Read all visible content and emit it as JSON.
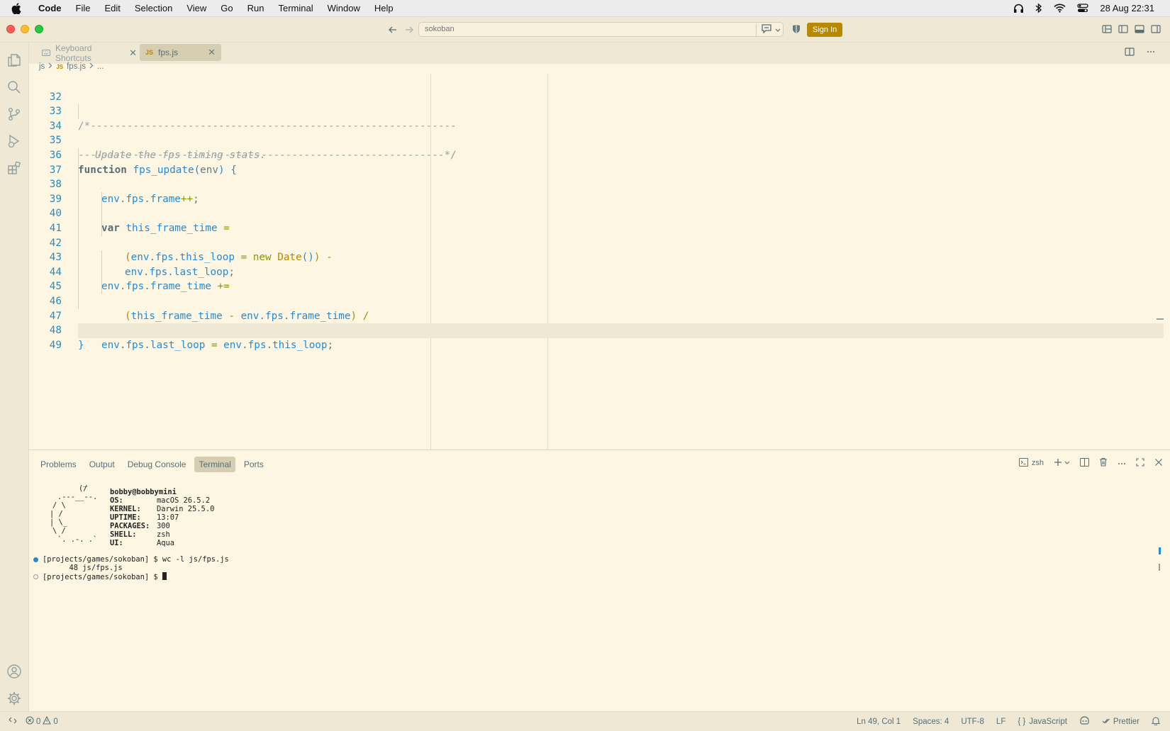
{
  "menubar": {
    "app": "Code",
    "items": [
      "File",
      "Edit",
      "Selection",
      "View",
      "Go",
      "Run",
      "Terminal",
      "Window",
      "Help"
    ],
    "clock": "28 Aug  22:31"
  },
  "titlebar": {
    "search": "sokoban",
    "signin": "Sign In"
  },
  "tabs": [
    {
      "label": "Keyboard Shortcuts",
      "active": false
    },
    {
      "label": "fps.js",
      "active": true,
      "icon": "JS"
    }
  ],
  "breadcrumb": {
    "folder": "js",
    "file_icon": "JS",
    "file": "fps.js",
    "more": "..."
  },
  "editor": {
    "line_numbers": [
      "32",
      "33",
      "34",
      "35",
      "36",
      "37",
      "38",
      "39",
      "40",
      "41",
      "42",
      "43",
      "44",
      "45",
      "46",
      "47",
      "48",
      "49"
    ],
    "comment_top": "/*------------------------------------------------------------",
    "comment_body": "Update the fps timing stats.",
    "comment_bottom": "------------------------------------------------------------*/"
  },
  "panel": {
    "tabs": [
      "Problems",
      "Output",
      "Debug Console",
      "Terminal",
      "Ports"
    ],
    "active_tab": "Terminal",
    "shell": "zsh"
  },
  "terminal": {
    "user": "bobby@bobbymini",
    "info": [
      {
        "key": "OS:",
        "value": "macOS 26.5.2"
      },
      {
        "key": "KERNEL:",
        "value": "Darwin 25.5.0"
      },
      {
        "key": "UPTIME:",
        "value": "13:07"
      },
      {
        "key": "PACKAGES:",
        "value": "300"
      },
      {
        "key": "SHELL:",
        "value": "zsh"
      },
      {
        "key": "UI:",
        "value": "Aqua"
      }
    ],
    "prompt1": "[projects/games/sokoban] $ wc -l js/fps.js",
    "output1": "      48 js/fps.js",
    "prompt2": "[projects/games/sokoban] $ "
  },
  "statusbar": {
    "errors": "0",
    "warnings": "0",
    "position": "Ln 49, Col 1",
    "spaces": "Spaces: 4",
    "encoding": "UTF-8",
    "eol": "LF",
    "language_icon": "{ }",
    "language": "JavaScript",
    "formatter": "Prettier"
  },
  "colors": {
    "background": "#fdf6e3",
    "sidebar": "#eee8d5",
    "accent": "#b58900",
    "blue": "#268bd2",
    "green": "#859900"
  }
}
